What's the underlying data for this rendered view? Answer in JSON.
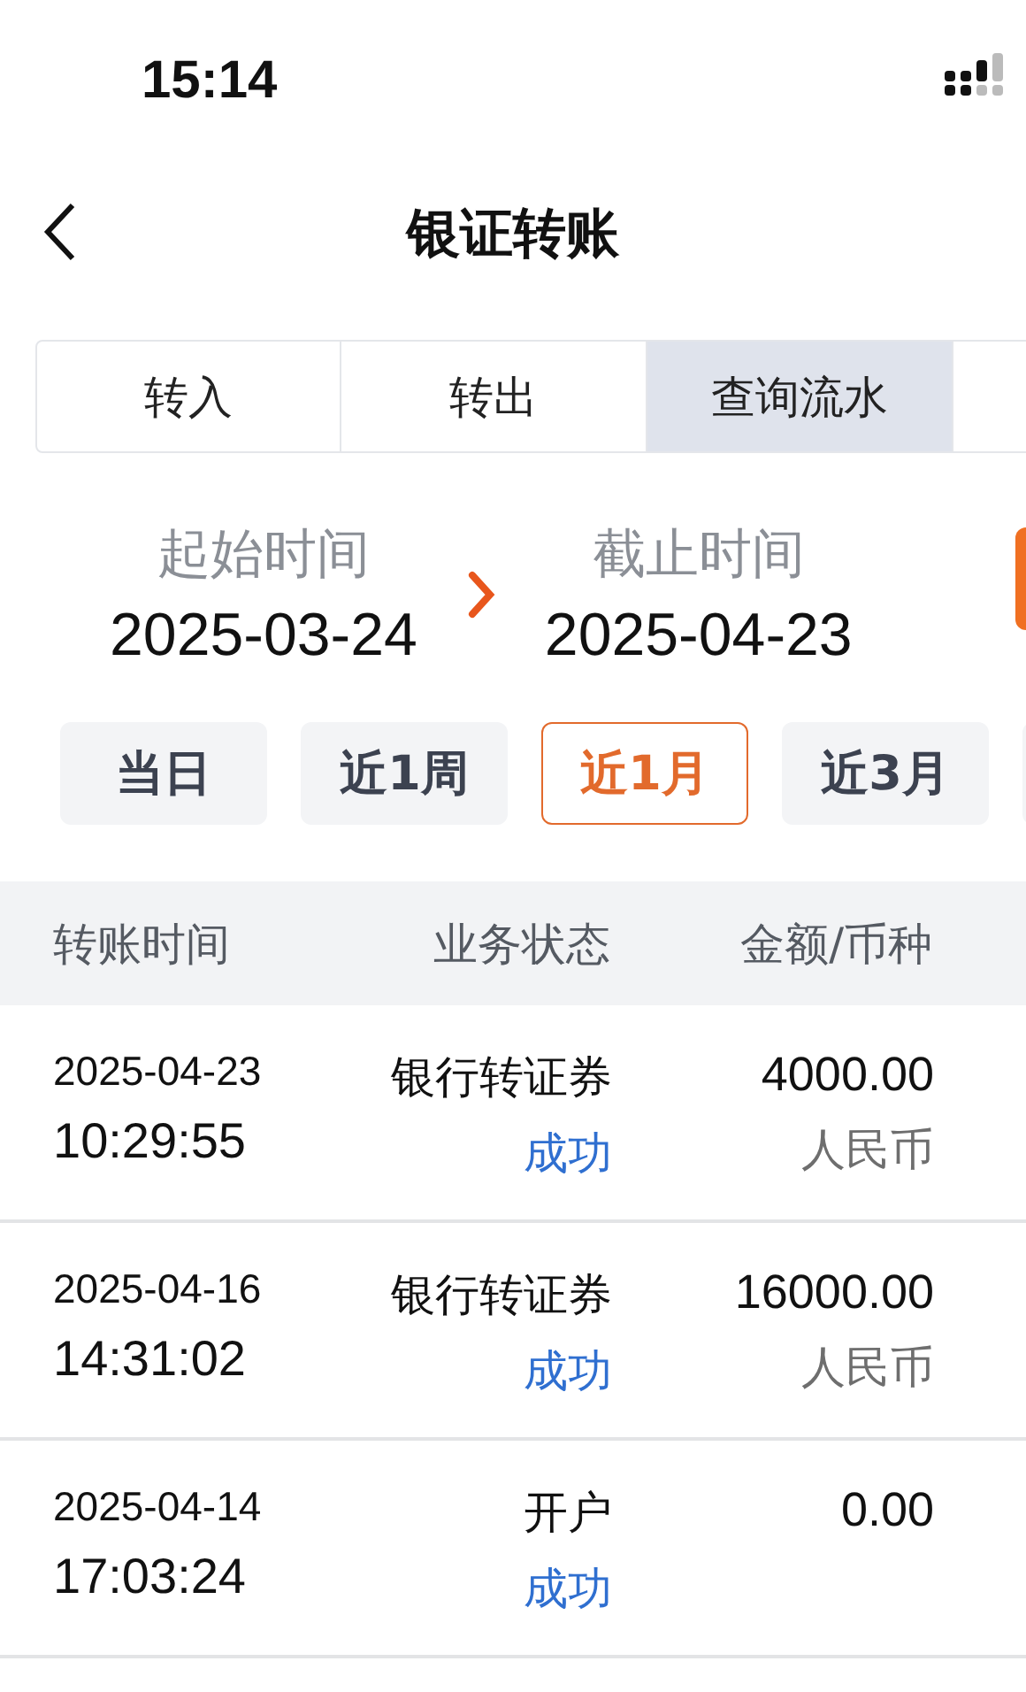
{
  "status_bar": {
    "time": "15:14"
  },
  "header": {
    "title": "银证转账"
  },
  "tabs": [
    {
      "label": "转入",
      "selected": false
    },
    {
      "label": "转出",
      "selected": false
    },
    {
      "label": "查询流水",
      "selected": true
    }
  ],
  "date_range": {
    "start_label": "起始时间",
    "start": "2025-03-24",
    "end_label": "截止时间",
    "end": "2025-04-23"
  },
  "filters": [
    {
      "label": "当日",
      "selected": false
    },
    {
      "label": "近1周",
      "selected": false
    },
    {
      "label": "近1月",
      "selected": true
    },
    {
      "label": "近3月",
      "selected": false
    }
  ],
  "table": {
    "columns": [
      "转账时间",
      "业务状态",
      "金额/币种"
    ],
    "rows": [
      {
        "date": "2025-04-23",
        "time": "10:29:55",
        "business": "银行转证券",
        "status": "成功",
        "amount": "4000.00",
        "currency": "人民币"
      },
      {
        "date": "2025-04-16",
        "time": "14:31:02",
        "business": "银行转证券",
        "status": "成功",
        "amount": "16000.00",
        "currency": "人民币"
      },
      {
        "date": "2025-04-14",
        "time": "17:03:24",
        "business": "开户",
        "status": "成功",
        "amount": "0.00"
      }
    ]
  }
}
